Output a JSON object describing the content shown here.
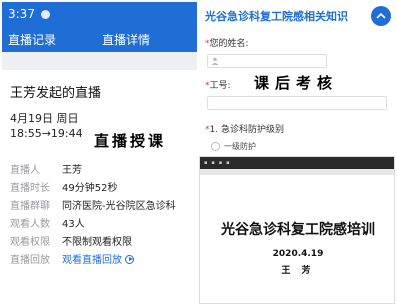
{
  "status_bar": {
    "time": "3:37"
  },
  "tabs": {
    "records": "直播记录",
    "details": "直播详情"
  },
  "live": {
    "title": "王芳发起的直播",
    "date": "4月19日 周日",
    "time_range": "18:55→19:44",
    "banner": "直播授课"
  },
  "info_rows": [
    {
      "key": "直播人",
      "value": "王芳"
    },
    {
      "key": "直播时长",
      "value": "49分钟52秒"
    },
    {
      "key": "直播群聊",
      "value": "同济医院-光谷院区急诊科"
    },
    {
      "key": "观看人数",
      "value": "43人"
    },
    {
      "key": "观看权限",
      "value": "不限制观看权限"
    },
    {
      "key": "直播回放",
      "value": "观看直播回放"
    }
  ],
  "form": {
    "header": "光谷急诊科复工院感相关知识",
    "name_label": "您的姓名:",
    "id_label": "工号:",
    "exam_title": "课后考核",
    "question": "1. 急诊科防护级别",
    "option": "一级防护"
  },
  "slide": {
    "title": "光谷急诊科复工院感培训",
    "date": "2020.4.19",
    "author": "王 芳"
  },
  "colors": {
    "accent": "#1e6ed6"
  }
}
